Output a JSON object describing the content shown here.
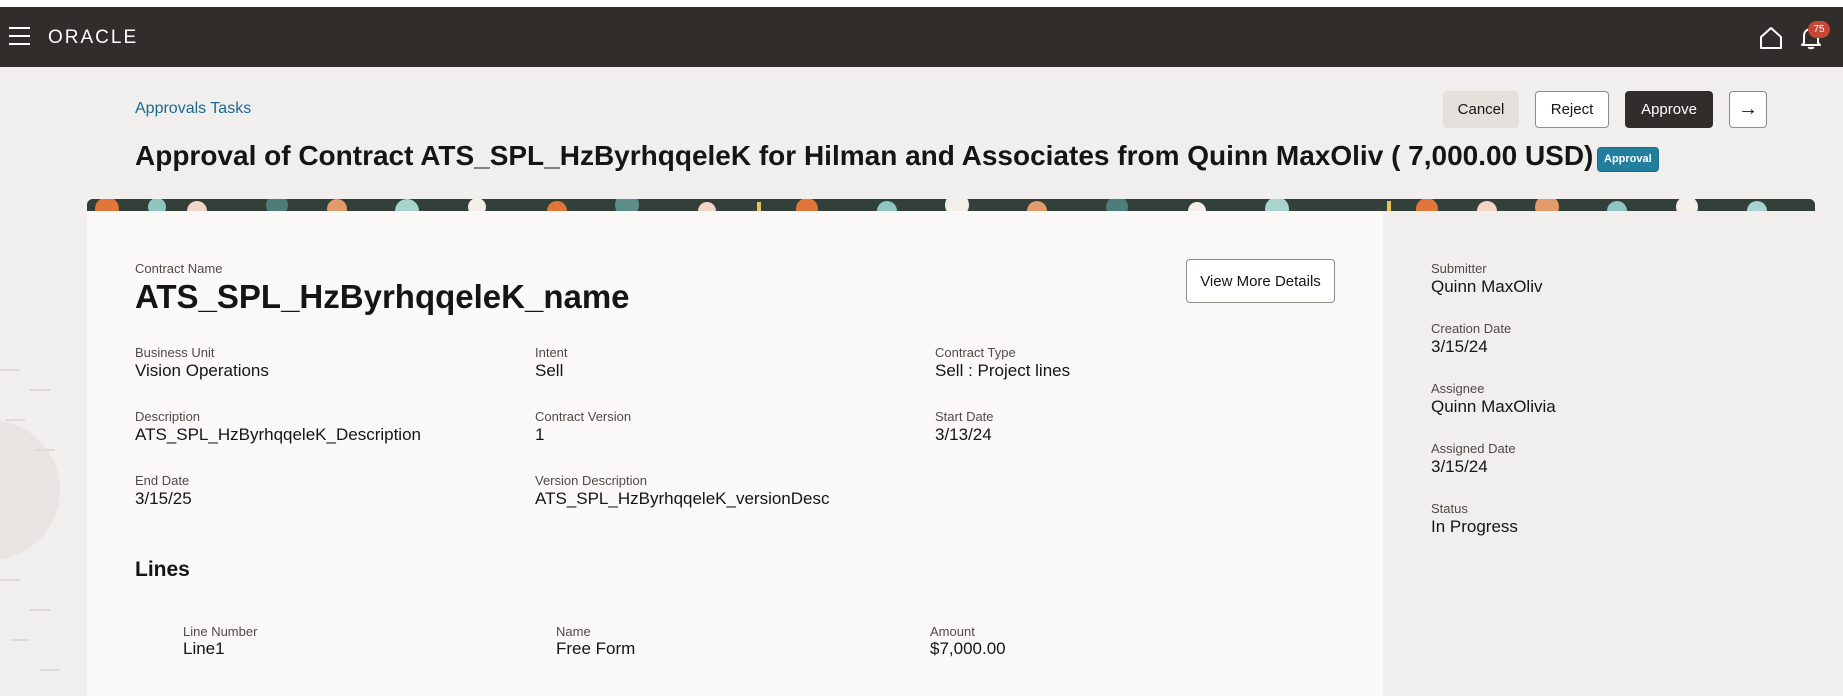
{
  "header": {
    "logo": "ORACLE",
    "notification_count": "75",
    "icons": [
      "hamburger-menu-icon",
      "home-icon",
      "bell-icon"
    ],
    "background_color": "#312d2a"
  },
  "breadcrumb": {
    "label": "Approvals Tasks"
  },
  "actions": {
    "cancel": "Cancel",
    "reject": "Reject",
    "approve": "Approve",
    "next_icon": "→"
  },
  "page_title": "Approval of Contract ATS_SPL_HzByrhqqeleK for Hilman and Associates from Quinn MaxOliv ( 7,000.00 USD)",
  "status_badge": "Approval",
  "contract": {
    "name_label": "Contract Name",
    "name": "ATS_SPL_HzByrhqqeleK_name",
    "view_more": "View More Details",
    "fields": {
      "business_unit": {
        "label": "Business Unit",
        "value": "Vision Operations"
      },
      "intent": {
        "label": "Intent",
        "value": "Sell"
      },
      "contract_type": {
        "label": "Contract Type",
        "value": "Sell : Project lines"
      },
      "description": {
        "label": "Description",
        "value": "ATS_SPL_HzByrhqqeleK_Description"
      },
      "contract_version": {
        "label": "Contract Version",
        "value": "1"
      },
      "start_date": {
        "label": "Start Date",
        "value": "3/13/24"
      },
      "end_date": {
        "label": "End Date",
        "value": "3/15/25"
      },
      "version_description": {
        "label": "Version Description",
        "value": "ATS_SPL_HzByrhqqeleK_versionDesc"
      }
    }
  },
  "lines": {
    "heading": "Lines",
    "columns": [
      "Line Number",
      "Name",
      "Amount"
    ],
    "rows": [
      [
        "Line1",
        "Free Form",
        "$7,000.00"
      ]
    ]
  },
  "sidebar": {
    "submitter": {
      "label": "Submitter",
      "value": "Quinn MaxOliv"
    },
    "creation_date": {
      "label": "Creation Date",
      "value": "3/15/24"
    },
    "assignee": {
      "label": "Assignee",
      "value": "Quinn MaxOlivia"
    },
    "assigned_date": {
      "label": "Assigned Date",
      "value": "3/15/24"
    },
    "status": {
      "label": "Status",
      "value": "In Progress"
    }
  },
  "colors": {
    "accent_link": "#1d6990",
    "approve_button": "#312d2a",
    "badge_teal": "#227e9e",
    "notification_red": "#c74634"
  }
}
